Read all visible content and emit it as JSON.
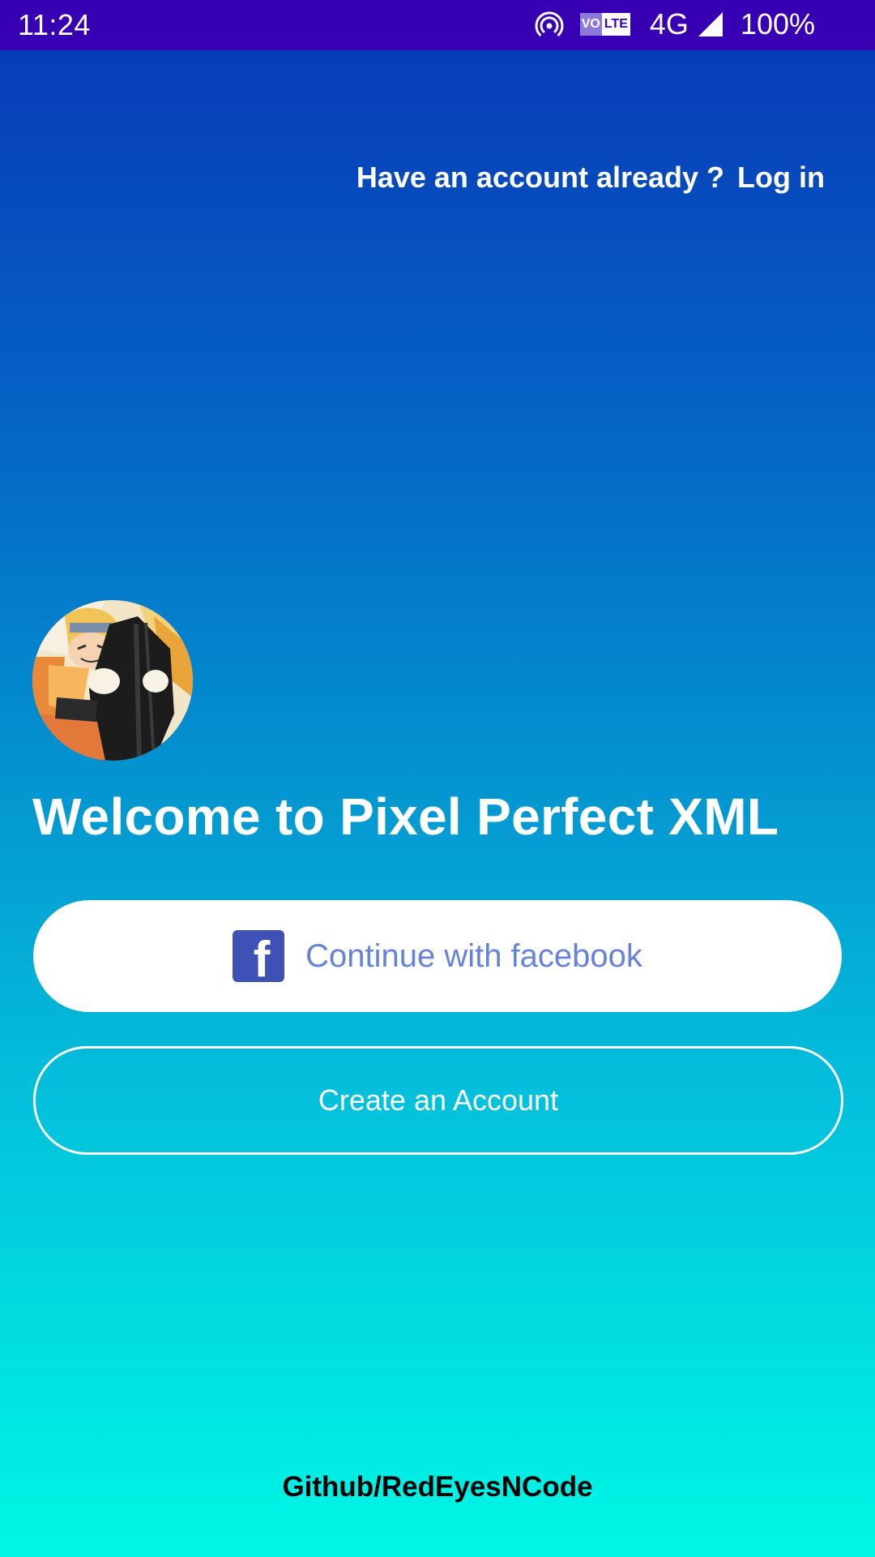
{
  "status_bar": {
    "time": "11:24",
    "volte_prefix": "VO",
    "volte_suffix": "LTE",
    "network": "4G",
    "battery": "100%",
    "background_color": "#3700b3"
  },
  "header": {
    "login_prompt": "Have an account already ?",
    "login_link": "Log in"
  },
  "main": {
    "avatar_icon": "anime-character-avatar",
    "title": "Welcome to Pixel Perfect XML",
    "facebook_button": {
      "icon": "facebook-icon",
      "label": "Continue with facebook",
      "label_color": "#6583dd"
    },
    "create_account_label": "Create an Account"
  },
  "footer": {
    "credit": "Github/RedEyesNCode"
  },
  "theme": {
    "gradient_top": "#0836b6",
    "gradient_bottom": "#00f7e6",
    "facebook_blue": "#3f51b5"
  }
}
